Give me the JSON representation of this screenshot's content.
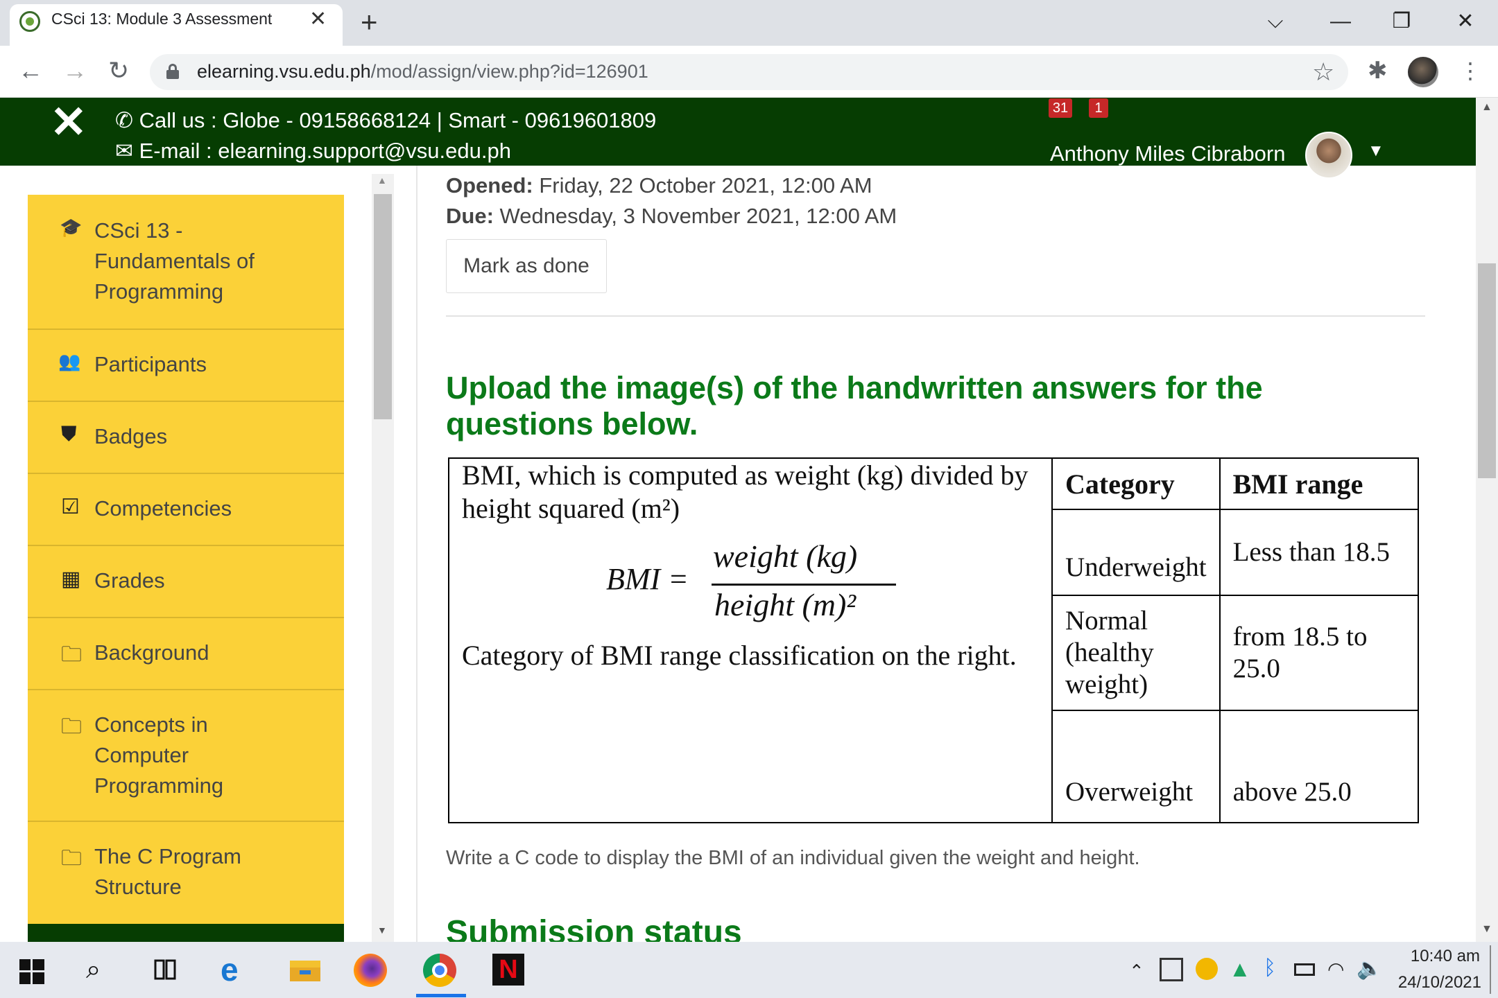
{
  "browser": {
    "tab_title": "CSci 13: Module 3 Assessment",
    "tab_close": "✕",
    "new_tab": "+",
    "url_domain": "elearning.vsu.edu.ph",
    "url_path": "/mod/assign/view.php?id=126901",
    "window_controls": {
      "dropdown": "⌵",
      "minimize": "—",
      "restore": "❐",
      "close": "✕"
    }
  },
  "header": {
    "call_text": "Call us : Globe - 09158668124 | Smart - 09619601809",
    "email_text": "E-mail : elearning.support@vsu.edu.ph",
    "messages_count": "31",
    "notifications_count": "1",
    "user_name": "Anthony Miles Cibraborn",
    "colors": {
      "header_bg": "#063d02",
      "sidebar_bg": "#fbd138",
      "heading": "#0b7a19"
    }
  },
  "sidebar": {
    "items": [
      {
        "label": "CSci 13 - Fundamentals of Programming",
        "icon": "graduation-cap-icon",
        "glyph": "🎓"
      },
      {
        "label": "Participants",
        "icon": "users-icon",
        "glyph": "👥"
      },
      {
        "label": "Badges",
        "icon": "shield-icon",
        "glyph": "⛊"
      },
      {
        "label": "Competencies",
        "icon": "check-square-icon",
        "glyph": "☑"
      },
      {
        "label": "Grades",
        "icon": "table-icon",
        "glyph": "▦"
      },
      {
        "label": "Background",
        "icon": "folder-icon",
        "glyph": "🗀"
      },
      {
        "label": "Concepts in Computer Programming",
        "icon": "folder-icon",
        "glyph": "🗀"
      },
      {
        "label": "The C Program Structure",
        "icon": "folder-icon",
        "glyph": "🗀"
      }
    ]
  },
  "main": {
    "opened_label": "Opened:",
    "opened_value": "Friday, 22 October 2021, 12:00 AM",
    "due_label": "Due:",
    "due_value": "Wednesday, 3 November 2021, 12:00 AM",
    "mark_done": "Mark as done",
    "heading": "Upload the image(s) of the handwritten answers for the questions below.",
    "bmi_image": {
      "description": "BMI, which is computed as weight (kg) divided by height squared (m²)",
      "formula_lhs": "BMI =",
      "formula_num": "weight (kg)",
      "formula_den": "height (m)²",
      "category_text": "Category of BMI range classification on the right.",
      "table": {
        "headers": [
          "Category",
          "BMI range"
        ],
        "rows": [
          [
            "Underweight",
            "Less than 18.5"
          ],
          [
            "Normal (healthy weight)",
            "from 18.5 to 25.0"
          ],
          [
            "Overweight",
            "above 25.0"
          ]
        ]
      }
    },
    "instruction": "Write a C code to display the BMI of an individual given the weight and height.",
    "submission_status": "Submission status"
  },
  "taskbar": {
    "time": "10:40 am",
    "date": "24/10/2021"
  }
}
